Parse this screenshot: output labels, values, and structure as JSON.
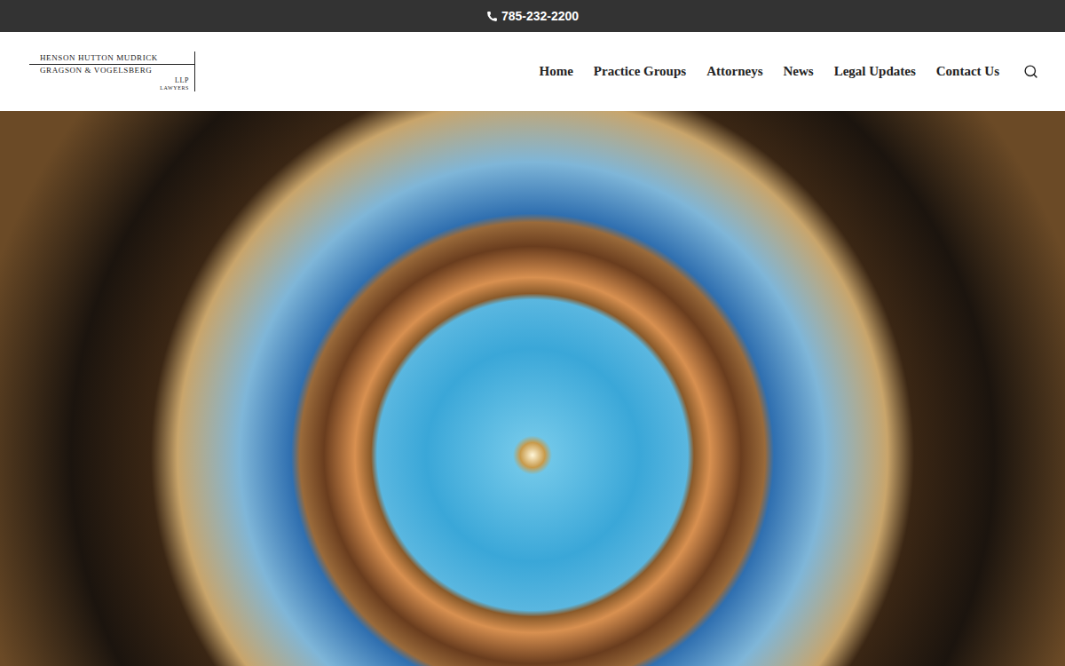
{
  "top_bar": {
    "phone": "785-232-2200"
  },
  "logo": {
    "lines": [
      "HENSON HUTTON MUDRICK",
      "GRAGSON & VOGELSBERG",
      "LLP",
      "LAWYERS"
    ]
  },
  "nav": {
    "items": [
      {
        "label": "Home"
      },
      {
        "label": "Practice Groups"
      },
      {
        "label": "Attorneys"
      },
      {
        "label": "News"
      },
      {
        "label": "Legal Updates"
      },
      {
        "label": "Contact Us"
      }
    ]
  }
}
